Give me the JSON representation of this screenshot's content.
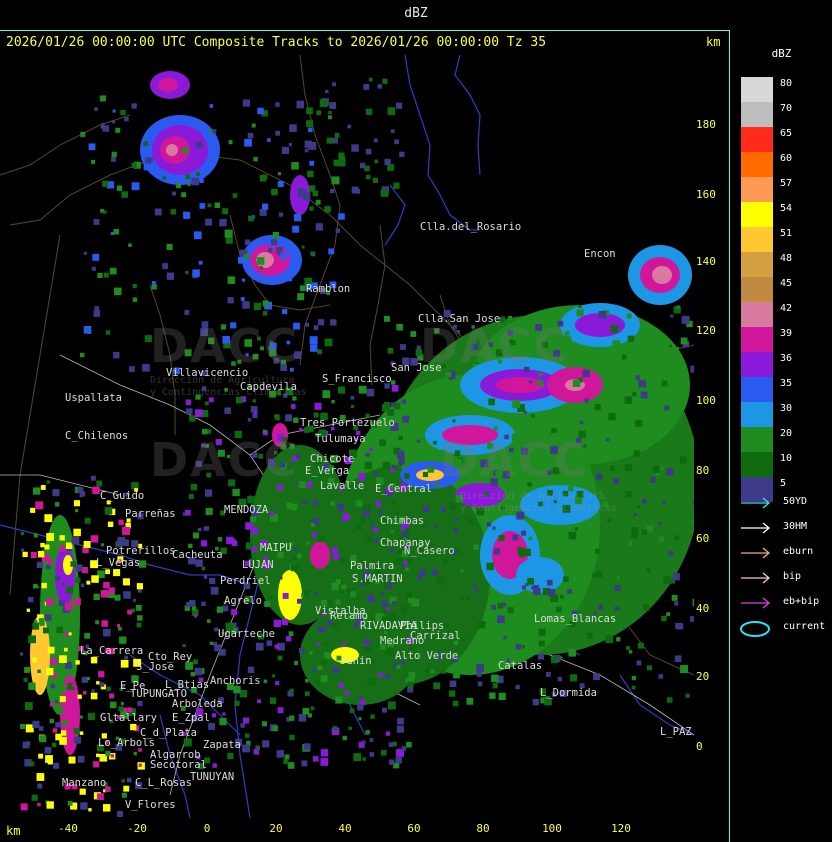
{
  "header": {
    "title": "dBZ"
  },
  "caption": "2026/01/26 00:00:00 UTC Composite Tracks to 2026/01/26 00:00:00 Tz 35",
  "axes": {
    "unit_top": "km",
    "unit_bottom": "km",
    "y_ticks": [
      "180",
      "160",
      "140",
      "120",
      "100",
      "80",
      "60",
      "40",
      "20",
      "0"
    ],
    "x_ticks": [
      "-40",
      "-20",
      "0",
      "20",
      "40",
      "60",
      "80",
      "100",
      "120"
    ]
  },
  "legend": {
    "title": "dBZ",
    "levels": [
      {
        "label": "80",
        "color": "#d8d8d8"
      },
      {
        "label": "70",
        "color": "#bdbdbd"
      },
      {
        "label": "65",
        "color": "#ff2a1a"
      },
      {
        "label": "60",
        "color": "#ff6a00"
      },
      {
        "label": "57",
        "color": "#ff9a55"
      },
      {
        "label": "54",
        "color": "#ffff00"
      },
      {
        "label": "51",
        "color": "#ffc832"
      },
      {
        "label": "48",
        "color": "#d4a040"
      },
      {
        "label": "45",
        "color": "#c08a40"
      },
      {
        "label": "42",
        "color": "#d87aa0"
      },
      {
        "label": "39",
        "color": "#d0169a"
      },
      {
        "label": "36",
        "color": "#8a1ad8"
      },
      {
        "label": "35",
        "color": "#2a5af0"
      },
      {
        "label": "30",
        "color": "#1e96e6"
      },
      {
        "label": "20",
        "color": "#1f8c1f"
      },
      {
        "label": "10",
        "color": "#0e6a0e"
      },
      {
        "label": "5",
        "color": "#3d3a8a"
      }
    ],
    "tracks": [
      {
        "label": "50YD",
        "color": "#40e0e0",
        "icon": "arrow-icon"
      },
      {
        "label": "30HM",
        "color": "#ffffff",
        "icon": "arrow-icon"
      },
      {
        "label": "eburn",
        "color": "#e8b070",
        "icon": "arrow-icon"
      },
      {
        "label": "bip",
        "color": "#ffc0d0",
        "icon": "arrow-icon"
      },
      {
        "label": "eb+bip",
        "color": "#e040e0",
        "icon": "arrow-icon"
      },
      {
        "label": "current",
        "color": "#30e0f0",
        "icon": "ellipse-icon"
      }
    ]
  },
  "watermark": {
    "logo_text": "DACC",
    "line1": "Dirección de Agricultura",
    "line2": "y Contingencias Climáticas"
  },
  "places": [
    "Clla.del_Rosario",
    "Encon",
    "Ramblon",
    "Clla.San Jose",
    "Villavicencio",
    "Uspallata",
    "Capdevila",
    "S_Francisco",
    "San Jose",
    "C_Chilenos",
    "Tres Portezuelo",
    "Tulumaya",
    "Chicote",
    "E_Verga",
    "Lavalle",
    "C_Guido",
    "MENDOZA",
    "Parreñas",
    "Potrerillos",
    "Cacheuta",
    "L_Vegas",
    "MAIPU",
    "LUJAN",
    "Perdriel",
    "Agrelo",
    "Ugarteche",
    "Chapanay",
    "N_Casero",
    "S.MARTIN",
    "La_Carrera",
    "Cto_Rey",
    "S_Jose",
    "E_Pe",
    "TUPUNGATO",
    "Anchoris",
    "L_Btias",
    "Arboleda",
    "Gltallary",
    "E_Zpal",
    "Lo_Arbols",
    "C_d_Plata",
    "Zapata",
    "Algarrob",
    "Secotoral",
    "C_L_Rosas",
    "Manzano",
    "TUNUYAN",
    "V_Flores",
    "RIVADAVIA",
    "Lomas_Blancas",
    "Catalas",
    "L_Dormida",
    "L_PAZ",
    "Junin",
    "Medrano",
    "Carrizal",
    "Alto Verde",
    "Philips",
    "E_Central",
    "Palmira",
    "Chimbas",
    "Retamo",
    "Vistalba"
  ]
}
